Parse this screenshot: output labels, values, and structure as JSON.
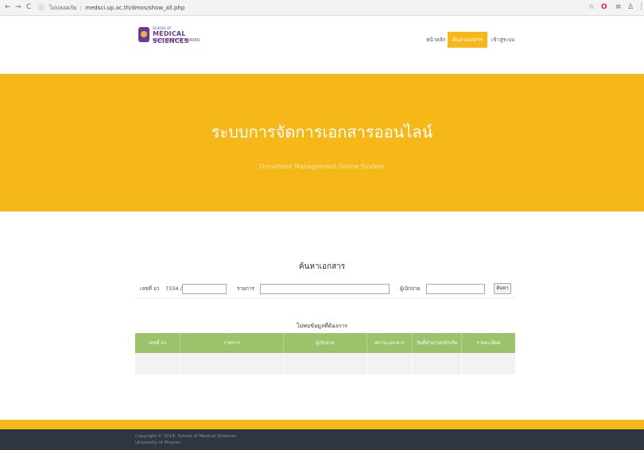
{
  "browser": {
    "back_icon": "←",
    "forward_icon": "→",
    "reload_icon": "C",
    "info_icon": "ⓘ",
    "security_text": "ไม่ปลอดภัย",
    "url": "medsci.up.ac.th/dmos/show_all.php",
    "star_icon": "☆",
    "opera_icon": "O",
    "ext_icon": "≡",
    "profile_icon": "♙",
    "menu_icon": "⋮"
  },
  "header": {
    "logo": {
      "line1": "SCHOOL OF",
      "line2": "MEDICAL SCIENCES",
      "line3": "UNIVERSITY OF PHAYAO"
    },
    "nav": [
      {
        "label": "หน้าหลัก",
        "active": false
      },
      {
        "label": "ค้นหาเอกสาร",
        "active": true
      },
      {
        "label": "เข้าสู่ระบบ",
        "active": false
      }
    ]
  },
  "hero": {
    "title": "ระบบการจัดการเอกสารออนไลน์",
    "subtitle": "Document Management Online System"
  },
  "search": {
    "title": "ค้นหาเอกสาร",
    "doc_no_label": "เลขที่ อว",
    "doc_no_prefix": "7334 /",
    "doc_no_value": "",
    "item_label": "รายการ",
    "item_value": "",
    "owner_label": "ผู้เบิกจ่าย",
    "owner_value": "",
    "button_label": "ค้นหา"
  },
  "results": {
    "message": "ไม่พบข้อมูลที่ต้องการ",
    "columns": [
      "เลขที่ อว",
      "รายการ",
      "ผู้เบิกจ่าย",
      "สถานะเอกสาร",
      "วันที่สามารถเบิกเงิน",
      "รายละเอียด"
    ]
  },
  "footer": {
    "copyright": "Copyright © 2018, School of Medical Sciences",
    "university": "University of Phayao"
  },
  "colors": {
    "accent": "#f6b719",
    "table_header": "#9cc26b",
    "footer_bg": "#2d3641",
    "brand_purple": "#6b3b94"
  }
}
